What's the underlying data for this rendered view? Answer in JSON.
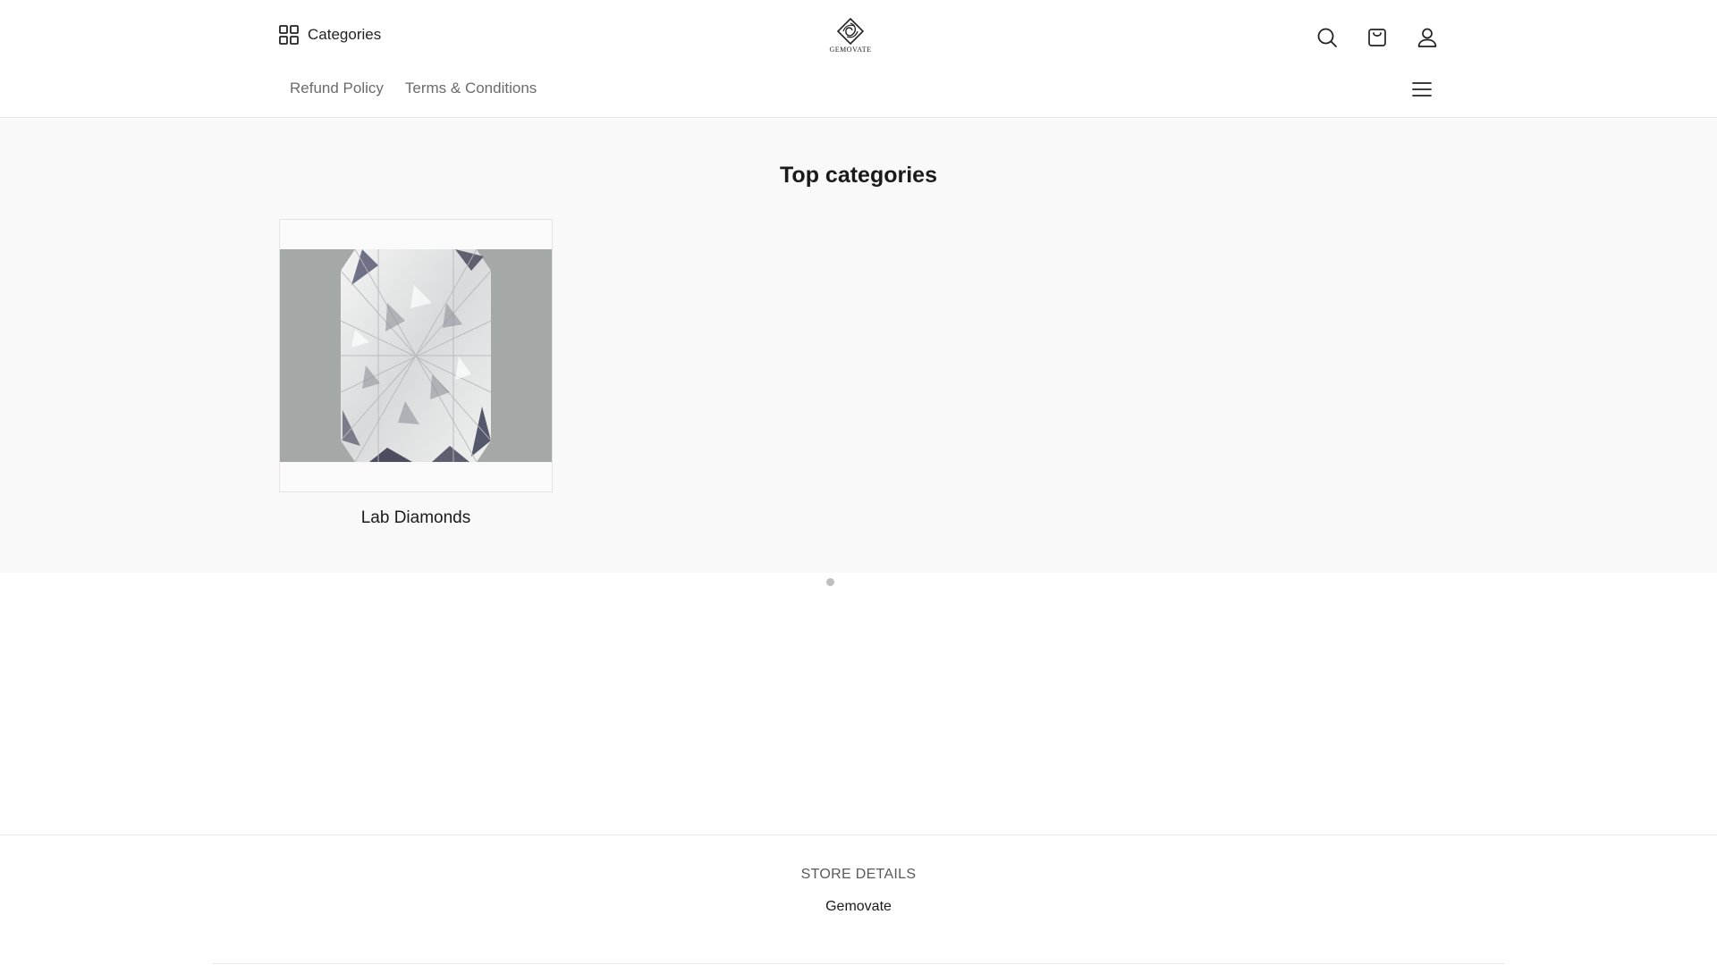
{
  "header": {
    "categories_label": "Categories",
    "logo_text": "GEMOVATE",
    "nav_links": [
      "Refund Policy",
      "Terms & Conditions"
    ],
    "icons": [
      "search-icon",
      "cart-icon",
      "account-icon",
      "menu-icon"
    ]
  },
  "main": {
    "section_title": "Top categories",
    "categories": [
      {
        "label": "Lab Diamonds"
      }
    ]
  },
  "footer": {
    "store_details_heading": "STORE DETAILS",
    "store_name": "Gemovate"
  },
  "colors": {
    "section_background": "#f9f9f9",
    "muted_text": "#6b6b6b",
    "photo_background": "#a4a9a7"
  }
}
